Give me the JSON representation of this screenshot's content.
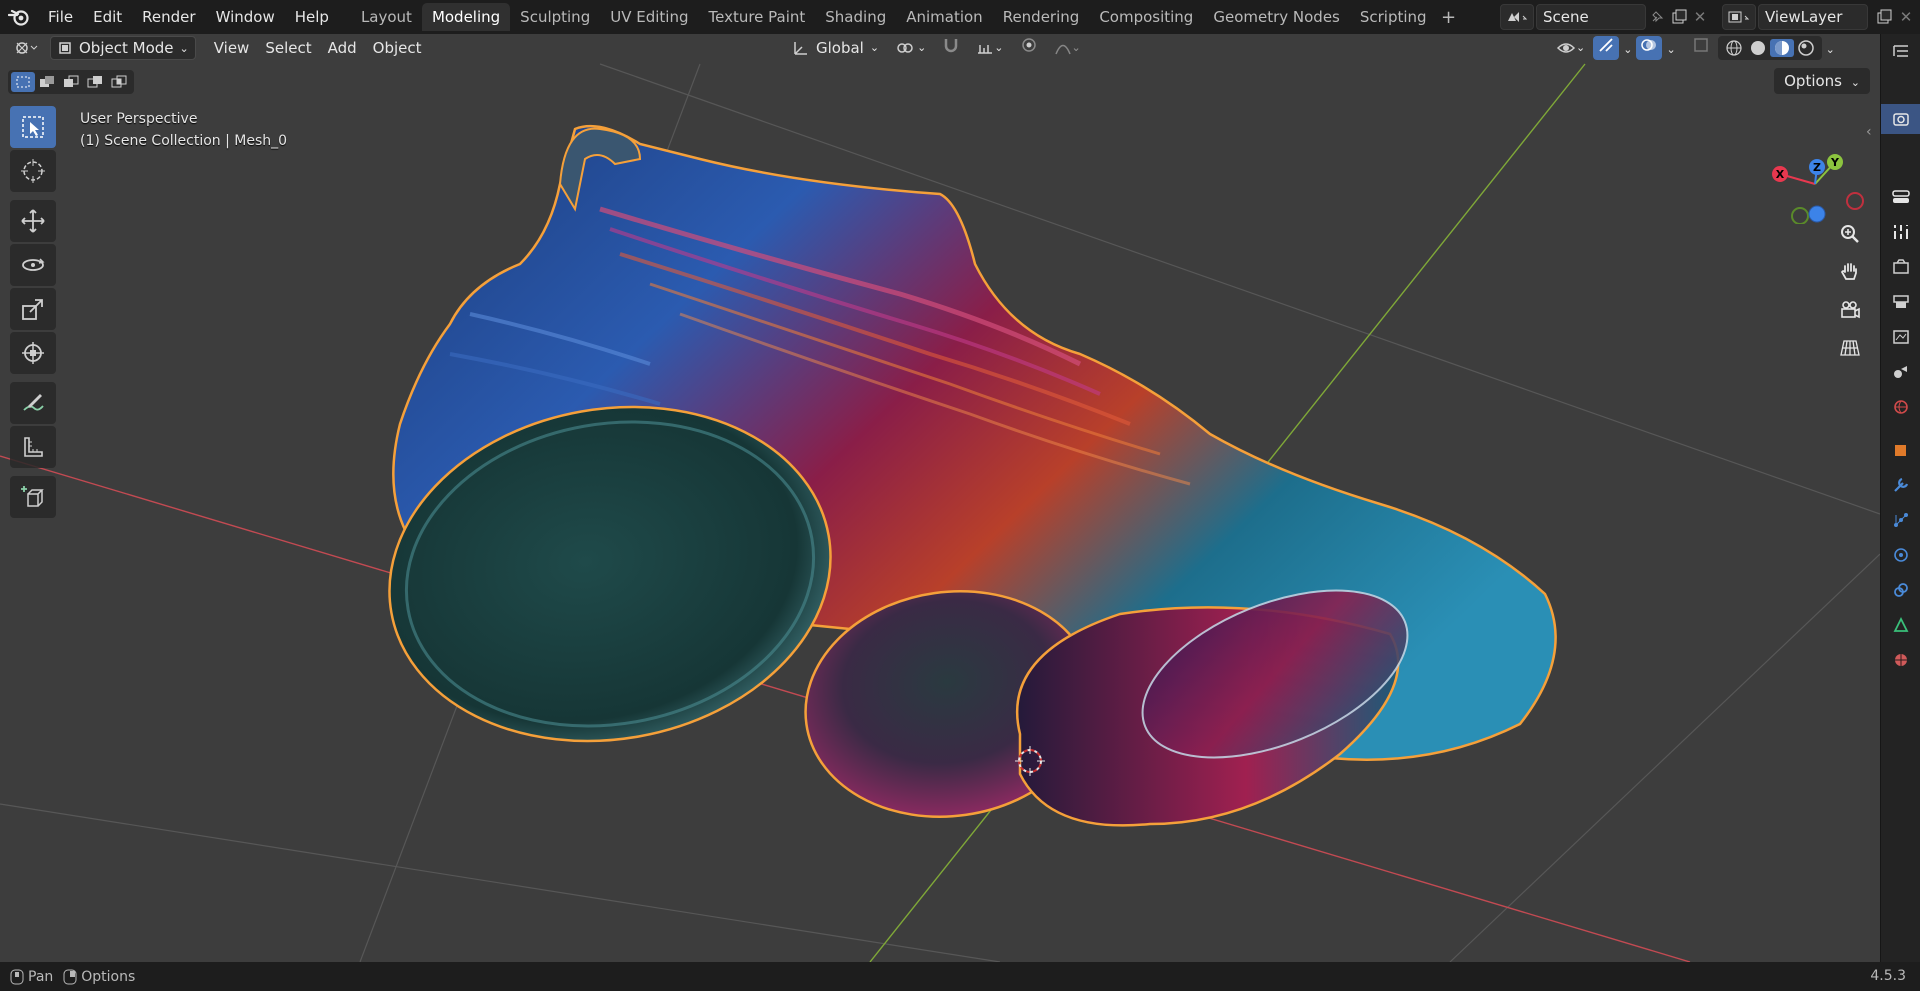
{
  "app": {
    "name": "Blender"
  },
  "menu": [
    "File",
    "Edit",
    "Render",
    "Window",
    "Help"
  ],
  "workspaces": [
    "Layout",
    "Modeling",
    "Sculpting",
    "UV Editing",
    "Texture Paint",
    "Shading",
    "Animation",
    "Rendering",
    "Compositing",
    "Geometry Nodes",
    "Scripting"
  ],
  "active_workspace": "Modeling",
  "scene": {
    "name": "Scene"
  },
  "view_layer": {
    "name": "ViewLayer"
  },
  "viewport_header": {
    "mode": "Object Mode",
    "menus": [
      "View",
      "Select",
      "Add",
      "Object"
    ],
    "orientation": "Global",
    "options_label": "Options"
  },
  "viewport_info": {
    "perspective": "User Perspective",
    "collection": "(1) Scene Collection | Mesh_0"
  },
  "gizmo": {
    "x_label": "X",
    "y_label": "Y",
    "z_label": "Z"
  },
  "statusbar": {
    "pan": "Pan",
    "options": "Options",
    "version": "4.5.3"
  },
  "colors": {
    "accent": "#4772b3",
    "x_axis": "#e8384f",
    "y_axis": "#8cc43f",
    "z_axis": "#3c83e8",
    "selection_outline": "#f5a03a"
  },
  "icons": {
    "tools": [
      "select-box-icon",
      "cursor-icon",
      "move-icon",
      "rotate-icon",
      "scale-icon",
      "transform-icon",
      "annotate-icon",
      "measure-icon",
      "add-cube-icon"
    ],
    "nav": [
      "zoom-icon",
      "pan-hand-icon",
      "camera-icon",
      "grid-perspective-icon"
    ],
    "properties": [
      "tool-icon",
      "render-icon",
      "output-icon",
      "view-layer-icon",
      "scene-icon",
      "world-icon",
      "object-icon",
      "modifier-icon",
      "particles-icon",
      "physics-icon",
      "constraints-icon",
      "data-icon",
      "material-icon"
    ]
  }
}
